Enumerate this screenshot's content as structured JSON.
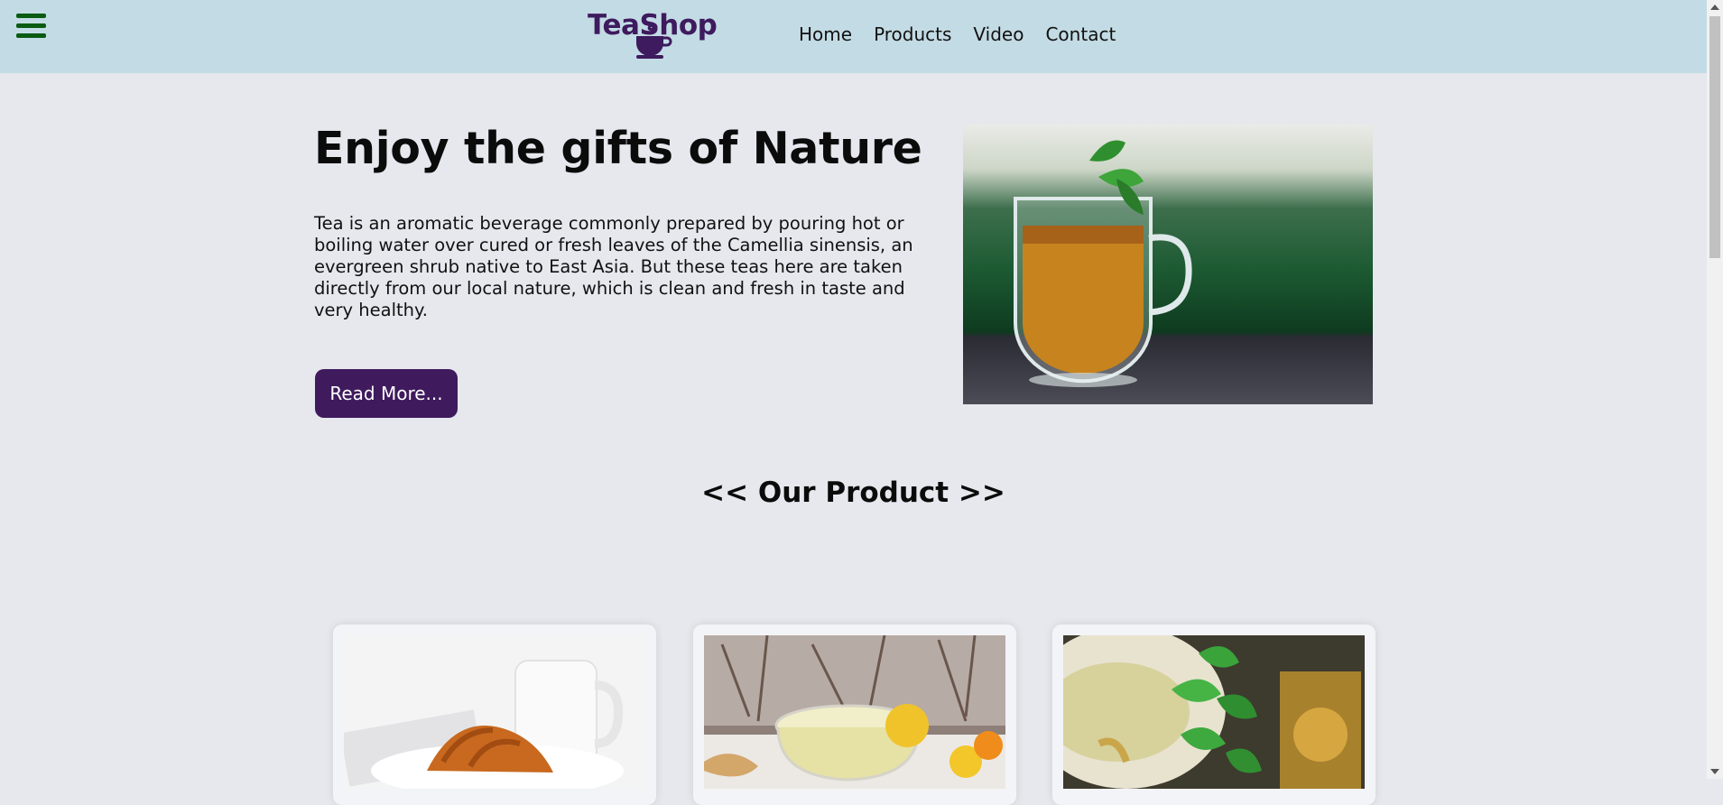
{
  "header": {
    "menu_icon": "hamburger-menu-icon",
    "logo": {
      "text": "TeaShop",
      "icon": "teacup-icon",
      "color": "#3e1a5e"
    },
    "nav": [
      {
        "label": "Home"
      },
      {
        "label": "Products"
      },
      {
        "label": "Video"
      },
      {
        "label": "Contact"
      }
    ],
    "background": "#c3dbe4"
  },
  "hero": {
    "title": "Enjoy the gifts of Nature",
    "text": "Tea is an aromatic beverage commonly prepared by pouring hot or boiling water over cured or fresh leaves of the Camellia sinensis, an evergreen shrub native to East Asia. But these teas here are taken directly from our local nature, which is clean and fresh in taste and very healthy.",
    "button_label": "Read More...",
    "button_color": "#3f1a5d",
    "image": "glass-cup-of-tea-with-mint-photo"
  },
  "products": {
    "title": "<< Our Product >>",
    "cards": [
      {
        "image": "croissant-and-coffee-mug-photo"
      },
      {
        "image": "ginger-lemon-tea-photo"
      },
      {
        "image": "mint-tea-cup-photo"
      }
    ]
  }
}
